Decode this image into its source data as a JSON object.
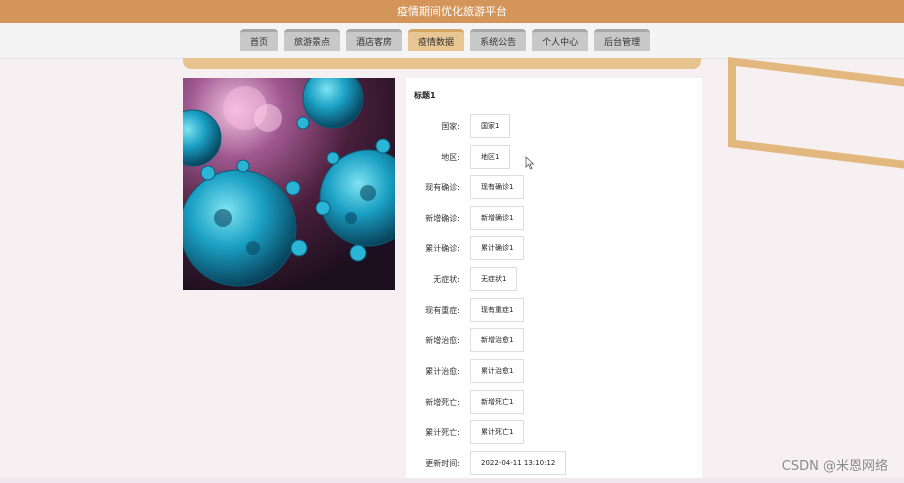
{
  "app": {
    "title": "疫情期间优化旅游平台"
  },
  "nav": {
    "items": [
      {
        "label": "首页"
      },
      {
        "label": "旅游景点"
      },
      {
        "label": "酒店客房"
      },
      {
        "label": "疫情数据"
      },
      {
        "label": "系统公告"
      },
      {
        "label": "个人中心"
      },
      {
        "label": "后台管理"
      }
    ],
    "active_index": 3
  },
  "detail": {
    "title": "标题1",
    "fields": [
      {
        "label": "国家:",
        "value": "国家1"
      },
      {
        "label": "地区:",
        "value": "地区1"
      },
      {
        "label": "现有确诊:",
        "value": "现有确诊1"
      },
      {
        "label": "新增确诊:",
        "value": "新增确诊1"
      },
      {
        "label": "累计确诊:",
        "value": "累计确诊1"
      },
      {
        "label": "无症状:",
        "value": "无症状1"
      },
      {
        "label": "现有重症:",
        "value": "现有重症1"
      },
      {
        "label": "新增治愈:",
        "value": "新增治愈1"
      },
      {
        "label": "累计治愈:",
        "value": "累计治愈1"
      },
      {
        "label": "新增死亡:",
        "value": "新增死亡1"
      },
      {
        "label": "累计死亡:",
        "value": "累计死亡1"
      },
      {
        "label": "更新时间:",
        "value": "2022-04-11 13:10:12"
      }
    ]
  },
  "watermark": "CSDN @米恩网络",
  "colors": {
    "header": "#d4955a",
    "accent": "#e6c38f",
    "active_tab": "#e8c694"
  }
}
